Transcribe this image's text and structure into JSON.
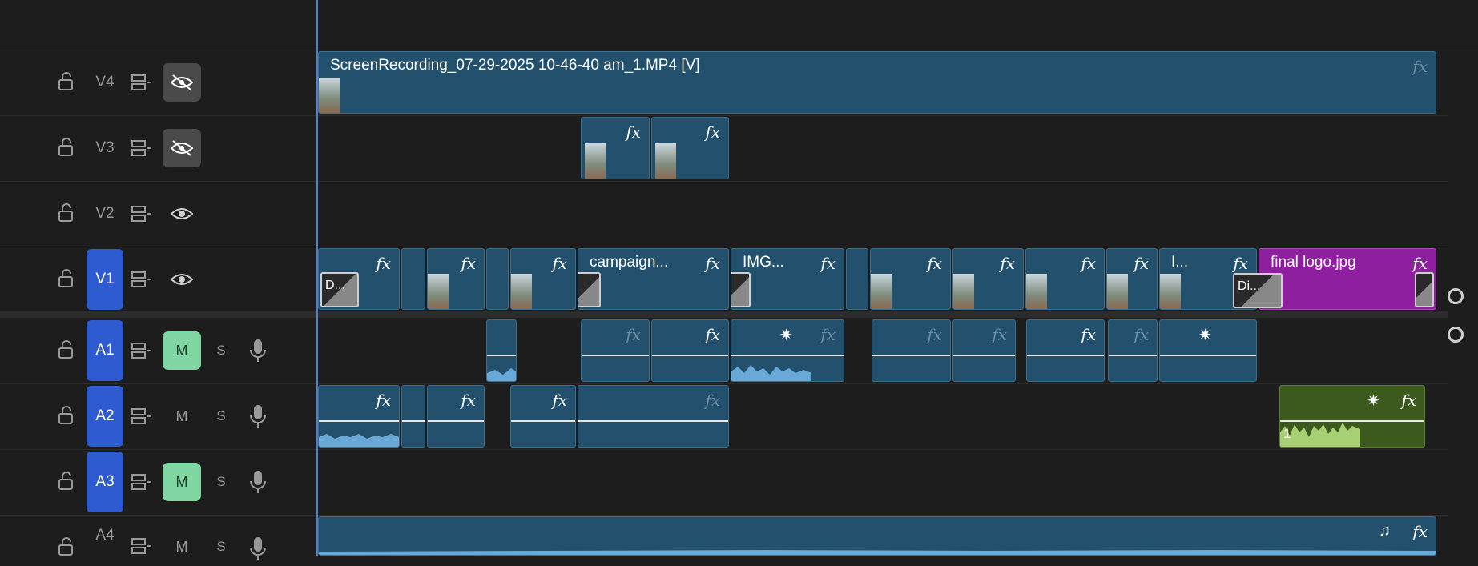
{
  "tracks": {
    "v4": {
      "name": "V4"
    },
    "v3": {
      "name": "V3"
    },
    "v2": {
      "name": "V2"
    },
    "v1": {
      "name": "V1"
    },
    "a1": {
      "name": "A1",
      "mute": "M",
      "solo": "S"
    },
    "a2": {
      "name": "A2",
      "mute": "M",
      "solo": "S"
    },
    "a3": {
      "name": "A3",
      "mute": "M",
      "solo": "S"
    },
    "a4": {
      "name": "A4",
      "mute": "M",
      "solo": "S"
    }
  },
  "clips": {
    "v4_main": "ScreenRecording_07-29-2025 10-46-40 am_1.MP4 [V]",
    "v1_campaign": "campaign...",
    "v1_img": "IMG...",
    "v1_i": "I...",
    "v1_final_logo": "final logo.jpg",
    "trans_d": "D...",
    "trans_di": "Di...",
    "a2_green_num": "1"
  },
  "glyphs": {
    "fx": "fx",
    "star": "✷",
    "music": "♫"
  },
  "colors": {
    "video_clip": "#22506d",
    "selected_track": "#2f5bd1",
    "mute_on": "#7fd6a2",
    "logo_clip": "#8e1f9e",
    "audio_green": "#3d5a1e",
    "playhead": "#4d7fd8"
  }
}
